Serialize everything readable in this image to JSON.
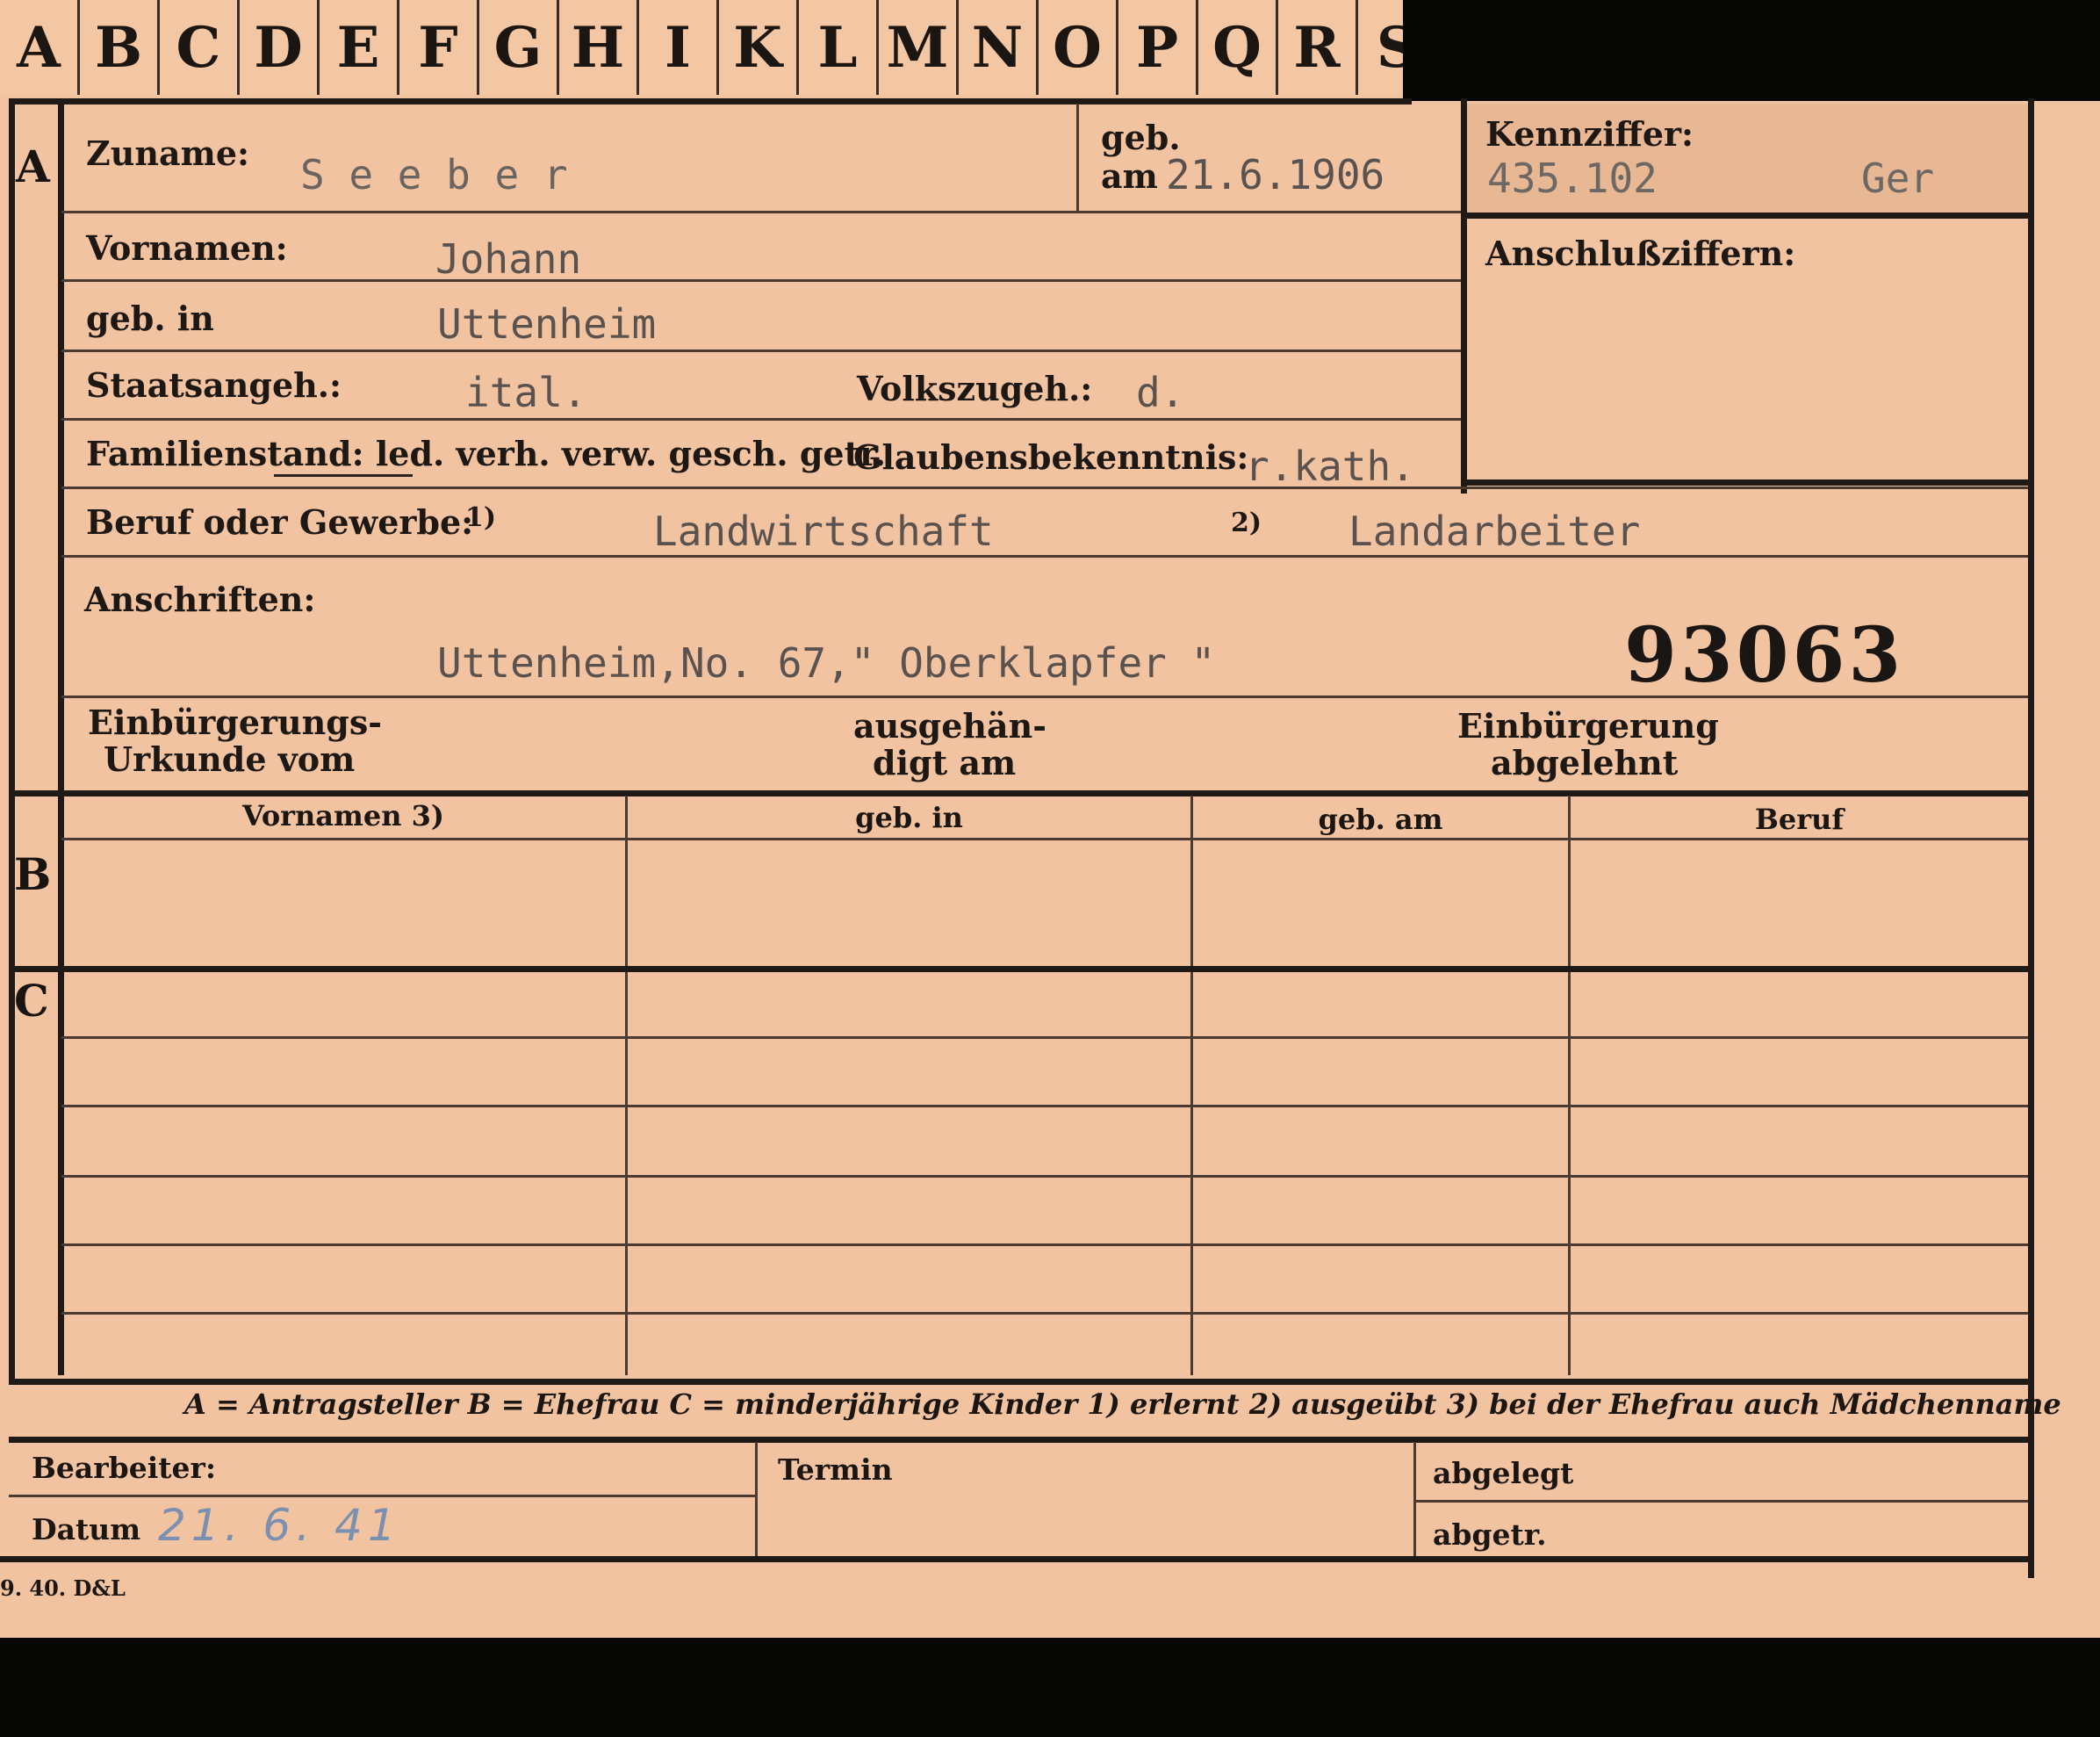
{
  "tabs": [
    "A",
    "B",
    "C",
    "D",
    "E",
    "F",
    "G",
    "H",
    "I",
    "K",
    "L",
    "M",
    "N",
    "O",
    "P",
    "Q",
    "R",
    "S"
  ],
  "sections": {
    "a": "A",
    "b": "B",
    "c": "C"
  },
  "fields": {
    "zuname_label": "Zuname:",
    "zuname_value": "S e e b e r",
    "geb_am_label_1": "geb.",
    "geb_am_label_2": "am",
    "geb_am_value": "21.6.1906",
    "kennziffer_label": "Kennziffer:",
    "kennziffer_value": "435.102",
    "kennziffer_suffix": "Ger",
    "anschluss_label": "Anschlußziffern:",
    "vornamen_label": "Vornamen:",
    "vornamen_value": "Johann",
    "gebin_label": "geb. in",
    "gebin_value": "Uttenheim",
    "staat_label": "Staatsangeh.:",
    "staat_value": "ital.",
    "volks_label": "Volkszugeh.:",
    "volks_value": "d.",
    "familien_label": "Familienstand: led. verh. verw. gesch. getr.",
    "glauben_label": "Glaubensbekenntnis:",
    "glauben_value": "r.kath.",
    "beruf_label": "Beruf oder Gewerbe:",
    "beruf_mark1": "1)",
    "beruf_value1": "Landwirtschaft",
    "beruf_mark2": "2)",
    "beruf_value2": "Landarbeiter",
    "anschriften_label": "Anschriften:",
    "anschriften_value": "Uttenheim,No. 67,\" Oberklapfer \"",
    "stamp_number": "93063",
    "einb1_line1": "Einbürgerungs-",
    "einb1_line2": "Urkunde vom",
    "ausg_line1": "ausgehän-",
    "ausg_line2": "digt am",
    "einb2_line1": "Einbürgerung",
    "einb2_line2": "abgelehnt"
  },
  "table": {
    "headers": [
      "Vornamen 3)",
      "geb. in",
      "geb. am",
      "Beruf"
    ]
  },
  "legend": "A = Antragsteller   B = Ehefrau   C = minderjährige Kinder   1) erlernt   2) ausgeübt   3) bei der Ehefrau auch Mädchenname",
  "footer": {
    "bearbeiter": "Bearbeiter:",
    "datum": "Datum",
    "datum_value": "21. 6. 41",
    "termin": "Termin",
    "abgelegt": "abgelegt",
    "abgetr": "abgetr.",
    "printmark": "9. 40. D&L"
  }
}
